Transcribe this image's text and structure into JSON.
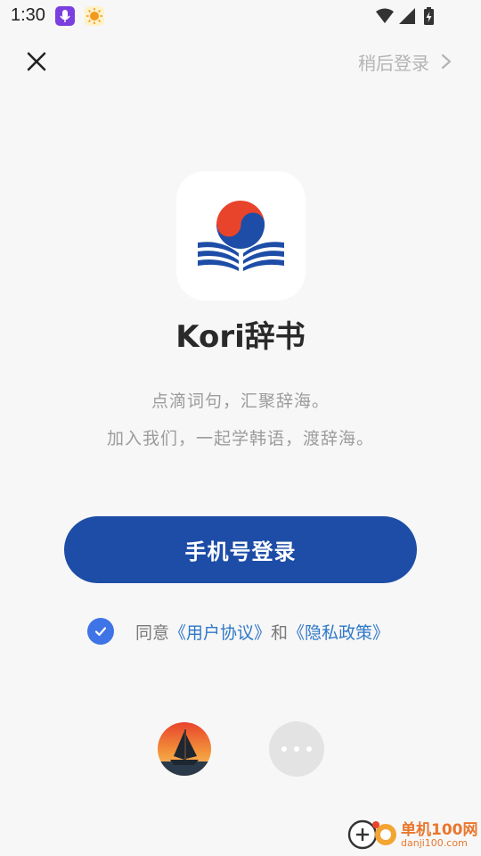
{
  "status_bar": {
    "time": "1:30",
    "notification_icons": [
      "mic-app-icon",
      "sun-app-icon"
    ],
    "system_icons": [
      "wifi-icon",
      "signal-icon",
      "battery-charging-icon"
    ]
  },
  "top_bar": {
    "close_icon": "close-icon",
    "later_login_label": "稍后登录",
    "later_login_icon": "chevron-right-icon"
  },
  "app": {
    "name": "Kori辞书",
    "slogan_line1": "点滴词句，汇聚辞海。",
    "slogan_line2": "加入我们，一起学韩语，渡辞海。"
  },
  "login": {
    "phone_login_label": "手机号登录"
  },
  "agreement": {
    "checked": true,
    "prefix": "同意",
    "user_agreement": "《用户协议》",
    "and": "和",
    "privacy_policy": "《隐私政策》"
  },
  "social_login": {
    "options": [
      "sailboat-app-icon",
      "more-options-icon"
    ]
  },
  "watermark": {
    "title": "单机100网",
    "url": "danji100.com"
  },
  "colors": {
    "primary": "#1d4da7",
    "checkbox": "#3f74e6",
    "link": "#2f78c8",
    "logo_red": "#e8442c",
    "logo_blue": "#1d4da7",
    "background": "#f7f7f7"
  }
}
